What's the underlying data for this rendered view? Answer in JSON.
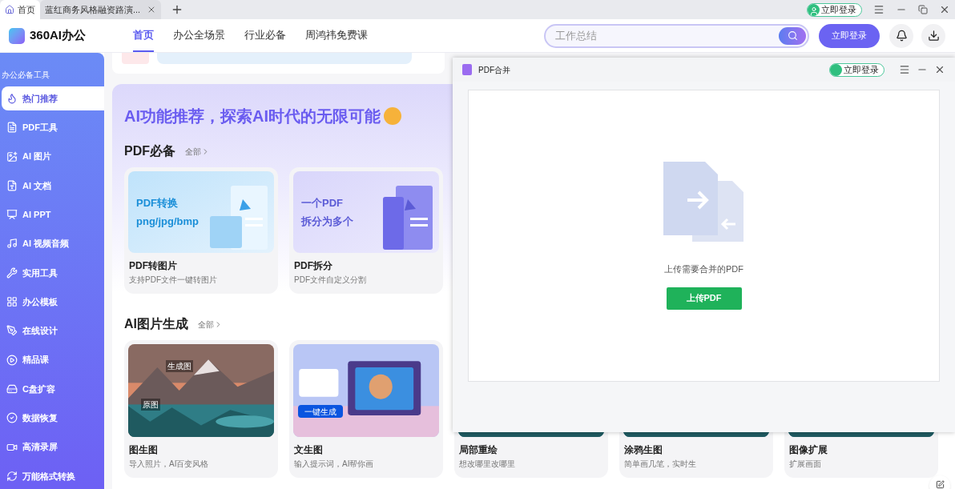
{
  "tabs": [
    {
      "label": "首页",
      "selected": true
    },
    {
      "label": "蓝红商务风格融资路演...",
      "selected": false,
      "closable": true
    }
  ],
  "titlebar": {
    "login": "立即登录"
  },
  "header": {
    "logo": "360AI办公",
    "nav": [
      {
        "label": "首页",
        "selected": true
      },
      {
        "label": "办公全场景",
        "selected": false
      },
      {
        "label": "行业必备",
        "selected": false
      },
      {
        "label": "周鸿祎免费课",
        "selected": false
      }
    ],
    "search": {
      "placeholder": "工作总结"
    },
    "login_button": "立即登录"
  },
  "sidebar": {
    "heading": "办公必备工具",
    "items": [
      {
        "label": "热门推荐",
        "selected": true
      },
      {
        "label": "PDF工具",
        "selected": false
      },
      {
        "label": "AI 图片",
        "selected": false
      },
      {
        "label": "AI 文档",
        "selected": false
      },
      {
        "label": "AI PPT",
        "selected": false
      },
      {
        "label": "AI 视频音频",
        "selected": false
      },
      {
        "label": "实用工具",
        "selected": false
      },
      {
        "label": "办公模板",
        "selected": false
      },
      {
        "label": "在线设计",
        "selected": false
      },
      {
        "label": "精品课",
        "selected": false
      },
      {
        "label": "C盘扩容",
        "selected": false
      },
      {
        "label": "数据恢复",
        "selected": false
      },
      {
        "label": "高清录屏",
        "selected": false
      },
      {
        "label": "万能格式转换",
        "selected": false
      }
    ]
  },
  "banner": {
    "title": "AI功能推荐，探索AI时代的无限可能"
  },
  "sections": [
    {
      "title": "PDF必备",
      "more": "全部",
      "cards": [
        {
          "kind": "pdf-convert",
          "title": "PDF转图片",
          "desc": "支持PDF文件一键转图片",
          "art": [
            "PDF转换",
            "png/jpg/bmp"
          ]
        },
        {
          "kind": "pdf-split",
          "title": "PDF拆分",
          "desc": "PDF文件自定义分割",
          "art": [
            "一个PDF",
            "拆分为多个"
          ]
        }
      ]
    },
    {
      "title": "AI图片生成",
      "more": "全部",
      "cards": [
        {
          "kind": "photo-pair",
          "title": "图生图",
          "desc": "导入照片，AI百变风格",
          "art": [
            "生成图",
            "原图"
          ]
        },
        {
          "kind": "prompt",
          "title": "文生图",
          "desc": "输入提示词，AI帮你画",
          "art": [
            "一键生成"
          ]
        },
        {
          "title": "局部重绘",
          "desc": "想改哪里改哪里"
        },
        {
          "title": "涂鸦生图",
          "desc": "简单画几笔，实时生"
        },
        {
          "title": "图像扩展",
          "desc": "扩展画面"
        }
      ]
    }
  ],
  "dialog": {
    "title": "PDF合并",
    "login": "立即登录",
    "prompt": "上传需要合并的PDF",
    "upload_button": "上传PDF"
  }
}
